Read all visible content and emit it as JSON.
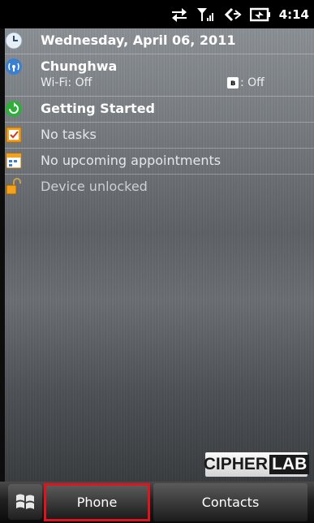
{
  "status_bar": {
    "icons": [
      "data-transfer-icon",
      "signal-icon",
      "volume-icon",
      "battery-charging-icon"
    ],
    "time": "4:14"
  },
  "today": {
    "date": "Wednesday, April 06, 2011",
    "carrier": {
      "name": "Chunghwa",
      "wifi": "Wi-Fi: Off",
      "bluetooth": ": Off"
    },
    "getting_started": "Getting Started",
    "tasks": "No tasks",
    "appointments": "No upcoming appointments",
    "lock": "Device unlocked"
  },
  "logo": {
    "part1": "CIPHER",
    "part2": "LAB"
  },
  "softkeys": {
    "left": "Phone",
    "right": "Contacts"
  },
  "colors": {
    "highlight": "#e0141e"
  }
}
